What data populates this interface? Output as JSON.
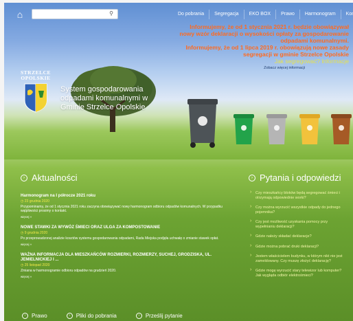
{
  "nav": {
    "home_icon": "home-icon",
    "search_placeholder": "",
    "search_icon": "search-icon",
    "items": [
      "Do pobrania",
      "Segregacja",
      "EKO BOX",
      "Prawo",
      "Harmonogram",
      "Kontakt"
    ]
  },
  "notice": {
    "line1": "Informujemy, że od 1 stycznia 2021 r. będzie obowiązywał",
    "line2": "nowy wzór deklaracji o wysokości opłaty za gospodarowanie",
    "line3": "odpadami komunalnymi.",
    "line4": "Informujemy, że od 1 lipca 2019 r. obowiązują nowe zasady",
    "line5": "segregacji w gminie Strzelce Opolskie",
    "line6": "Jak segregować? Informacje",
    "link": "Zobacz więcej informacji"
  },
  "logo": {
    "name_line1": "STRZELCE",
    "name_line2": "OPOLSKIE",
    "title": "System gospodarowania odpadami komunalnymi w Gminie Strzelce Opolskie"
  },
  "news": {
    "heading": "Aktualności",
    "items": [
      {
        "title": "Harmonogram na I półrocze 2021 roku",
        "date": "23 grudnia 2020",
        "text": "Przypominamy, że od 1 stycznia 2021 roku zaczyna obowiązywać nowy harmonogram odbioru odpadów komunalnych. W przypadku wątpliwości prosimy o kontakt.",
        "more": "więcej »"
      },
      {
        "title": "NOWE STAWKI ZA WYWÓZ ŚMIECI ORAZ ULGA ZA KOMPOSTOWANIE",
        "date": "9 grudnia 2020",
        "text": "Po przeprowadzonej analizie kosztów systemu gospodarowania odpadami, Rada Miejska podjęła uchwałę o zmianie stawek opłat.",
        "more": "więcej »"
      },
      {
        "title": "WAŻNA INFORMACJA DLA MIESZKAŃCÓW ROZMIERKI, ROZMIERZY, SUCHEJ, GRODZISKA, UL. JEMIELNICKIEJ I ...",
        "date": "25 listopad 2020",
        "text": "Zmiana w harmonogramie odbioru odpadów na grudzień 2020.",
        "more": "więcej »"
      }
    ]
  },
  "faq": {
    "heading": "Pytania i odpowiedzi",
    "items": [
      "Czy mieszkańcy bloków będą segregować śmieci i otrzymają odpowiednie worki?",
      "Czy można wyrzucić wszystkie odpady do jednego pojemnika?",
      "Czy jest możliwość uzyskania pomocy przy wypełnianiu deklaracji?",
      "Gdzie należy składać deklaracje?",
      "Gdzie można pobrać druki deklaracji?",
      "Jestem właścicielem budynku, w którym nikt nie jest zameldowany. Czy muszę złożyć deklarację?",
      "Gdzie mogę wyrzucić stary telewizor lub komputer? Jak wygląda odbiór elektrośmieci?"
    ]
  },
  "bottom": {
    "items": [
      "Prawo",
      "Pliki do pobrania",
      "Prześlij pytanie"
    ]
  },
  "colors": {
    "notice_orange": "#ff6a1f",
    "notice_yellow": "#e8e24a",
    "date_yellow": "#f2e94a"
  }
}
